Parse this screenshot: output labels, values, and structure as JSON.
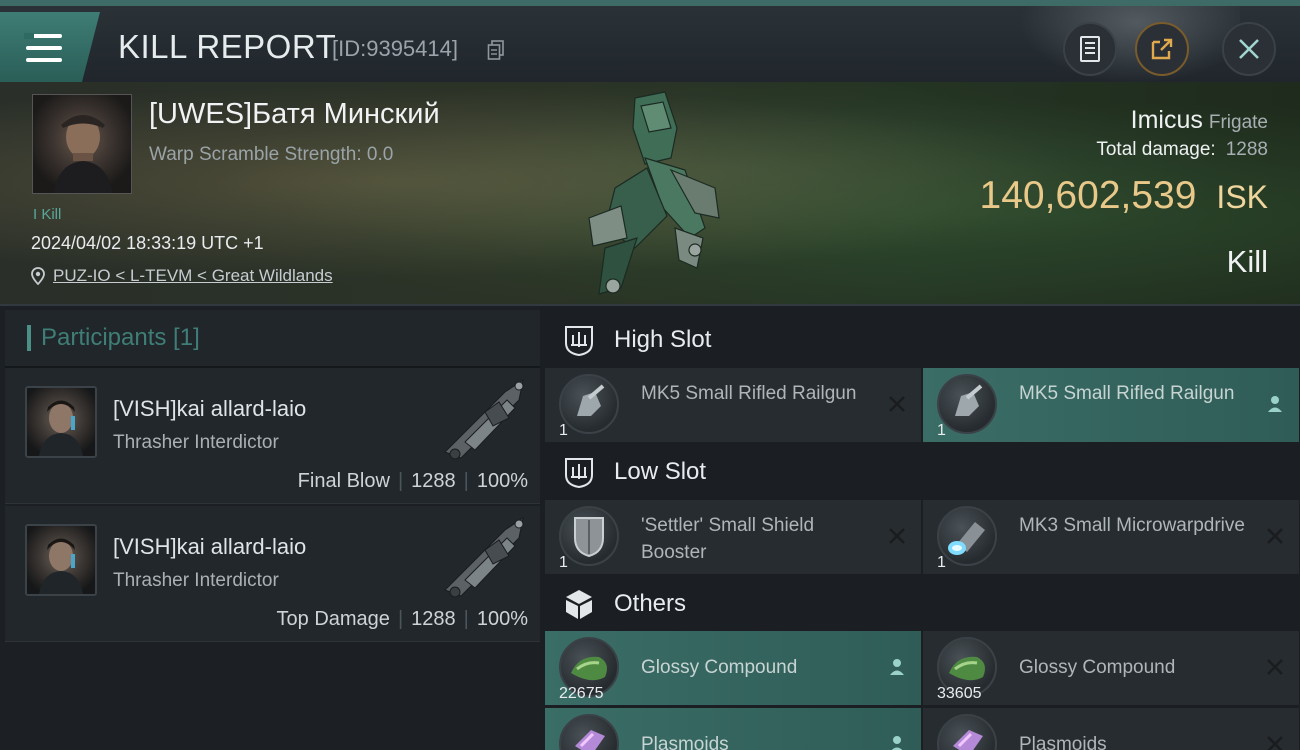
{
  "header": {
    "title": "KILL REPORT",
    "report_id": "[ID:9395414]"
  },
  "victim": {
    "name": "[UWES]Батя Минский",
    "warp_scramble": "Warp Scramble Strength: 0.0",
    "kill_count": "I Kill",
    "timestamp": "2024/04/02 18:33:19 UTC +1",
    "location": "PUZ-IO < L-TEVM < Great Wildlands"
  },
  "summary": {
    "ship_name": "Imicus",
    "ship_class": "Frigate",
    "total_damage_label": "Total damage:",
    "total_damage_value": "1288",
    "isk_value": "140,602,539",
    "isk_unit": "ISK",
    "kill_type": "Kill"
  },
  "participants": {
    "header": "Participants [1]",
    "rows": [
      {
        "name": "[VISH]kai allard-laio",
        "ship": "Thrasher Interdictor",
        "role": "Final Blow",
        "damage": "1288",
        "percent": "100%"
      },
      {
        "name": "[VISH]kai allard-laio",
        "ship": "Thrasher Interdictor",
        "role": "Top Damage",
        "damage": "1288",
        "percent": "100%"
      }
    ]
  },
  "slots": {
    "high": {
      "label": "High Slot",
      "items": [
        {
          "name": "MK5 Small Rifled Railgun",
          "qty": "1",
          "status": "destroyed",
          "icon": "railgun-icon"
        },
        {
          "name": "MK5 Small Rifled Railgun",
          "qty": "1",
          "status": "dropped",
          "icon": "railgun-icon"
        }
      ]
    },
    "low": {
      "label": "Low Slot",
      "items": [
        {
          "name": "'Settler' Small Shield Booster",
          "qty": "1",
          "status": "destroyed",
          "icon": "shield-booster-icon"
        },
        {
          "name": "MK3 Small Microwarpdrive",
          "qty": "1",
          "status": "destroyed",
          "icon": "microwarpdrive-icon"
        }
      ]
    },
    "others": {
      "label": "Others",
      "items": [
        {
          "name": "Glossy Compound",
          "qty": "22675",
          "status": "dropped",
          "icon": "glossy-compound-icon"
        },
        {
          "name": "Glossy Compound",
          "qty": "33605",
          "status": "destroyed",
          "icon": "glossy-compound-icon"
        },
        {
          "name": "Plasmoids",
          "qty": "",
          "status": "dropped",
          "icon": "plasmoids-icon"
        },
        {
          "name": "Plasmoids",
          "qty": "",
          "status": "destroyed",
          "icon": "plasmoids-icon"
        }
      ]
    }
  },
  "colors": {
    "accent": "#3e7d75",
    "isk_gold": "#e9c98a",
    "dropped_highlight": "#3b6d67"
  }
}
